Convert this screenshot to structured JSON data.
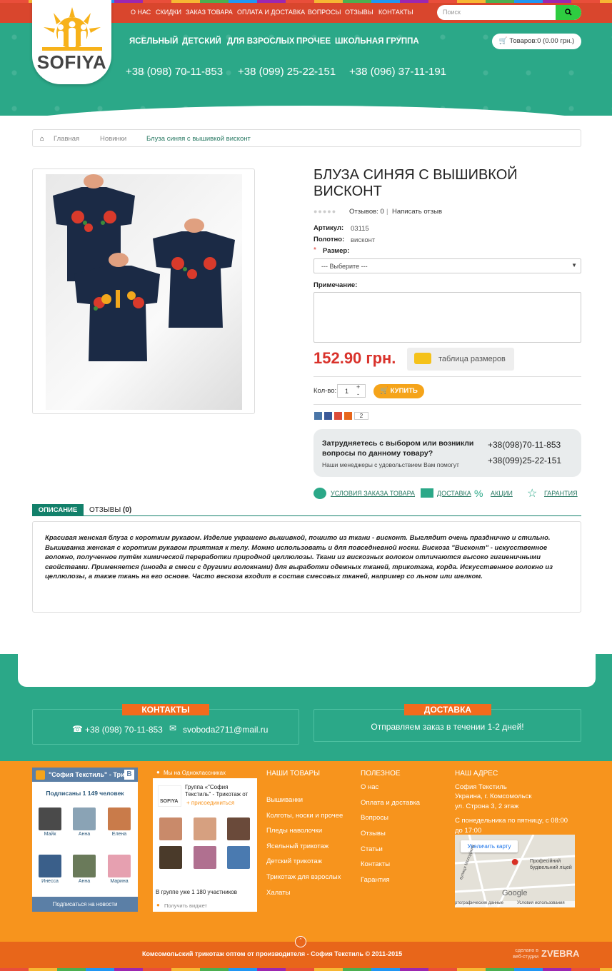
{
  "header": {
    "logo_text": "SOFIYA",
    "top_nav": [
      "О НАС",
      "СКИДКИ",
      "ЗАКАЗ ТОВАРА",
      "ОПЛАТА И ДОСТАВКА",
      "ВОПРОСЫ",
      "ОТЗЫВЫ",
      "КОНТАКТЫ"
    ],
    "search_placeholder": "Поиск",
    "categories": [
      "ЯСЕЛЬНЫЙ",
      "ДЕТСКИЙ",
      "ДЛЯ ВЗРОСЛЫХ",
      "ПРОЧЕЕ",
      "ШКОЛЬНАЯ ГРУППА"
    ],
    "phones": [
      "+38 (098) 70-11-853",
      "+38 (099) 25-22-151",
      "+38 (096) 37-11-191"
    ],
    "cart": "Товаров:0 (0.00 грн.)"
  },
  "breadcrumb": [
    "Главная",
    "Новинки",
    "Блуза синяя с вышивкой висконт"
  ],
  "product": {
    "title": "Блуза синяя с вышивкой висконт",
    "reviews": "Отзывов: 0",
    "write_review": "Написать отзыв",
    "sku_label": "Артикул:",
    "sku": "03115",
    "fabric_label": "Полотно:",
    "fabric": "висконт",
    "size_label": "Размер:",
    "size_select": "--- Выберите ---",
    "note_label": "Примечание:",
    "price": "152.90 грн.",
    "size_table": "таблица размеров",
    "qty_label": "Кол-во:",
    "qty": "1",
    "buy": "КУПИТЬ",
    "share_count": "2"
  },
  "help": {
    "question": "Затрудняетесь с выбором или возникли вопросы по данному товару?",
    "sub": "Наши менеджеры с удовольствием Вам помогут",
    "phone1": "+38(098)70-11-853",
    "phone2": "+38(099)25-22-151"
  },
  "links": [
    "УСЛОВИЯ ЗАКАЗА ТОВАРА",
    "ДОСТАВКА",
    "АКЦИИ",
    "ГАРАНТИЯ"
  ],
  "tabs": {
    "description": "ОПИСАНИЕ",
    "reviews": "ОТЗЫВЫ",
    "reviews_count": "(0)"
  },
  "description": "Красивая женская блуза с коротким рукавом. Изделие украшено вышивкой, пошито  из ткани - висконт. Выглядит очень празднично и стильно. Вышиванка женская с коротким рукавом приятная к телу. Можно использовать и для повседневной носки. Вискоза \"Висконт\" - искусственное волокно, полученное путём химической переработки природной целлюлозы. Ткани из вискозных волокон отличаются высоко гигиеничными свойствами. Применяется (иногда в смеси с другими волокнами) для выработки одежных тканей, трикотажа, корда. Искусственное волокно из целлюлозы, а также ткань на его основе. Часто вескоза входит в состав смесовых тканей, например со льном или шелком.",
  "contacts": {
    "title": "КОНТАКТЫ",
    "phone": "+38 (098) 70-11-853",
    "email": "svoboda2711@mail.ru"
  },
  "delivery": {
    "title": "ДОСТАВКА",
    "text": "Отправляем заказ в течении 1-2 дней!"
  },
  "vk": {
    "title": "\"София Текстиль\" - Три...",
    "subscribed": "Подписаны 1 149 человек",
    "names": [
      "Майк",
      "Анна",
      "Елена",
      "Инесса",
      "Анна",
      "Марина"
    ],
    "button": "Подписаться на новости"
  },
  "ok": {
    "title": "Мы на Одноклассниках",
    "group": "Группа «\"София Текстиль\" - Трикотаж от",
    "join": "присоединиться",
    "members": "В группе уже 1 180 участников",
    "get": "Получить виджет"
  },
  "footer": {
    "goods_title": "НАШИ ТОВАРЫ",
    "goods": [
      "Вышиванки",
      "Колготы, носки и прочее",
      "Пледы наволочки",
      "Ясельный трикотаж",
      "Детский трикотаж",
      "Трикотаж для взрослых",
      "Халаты"
    ],
    "useful_title": "ПОЛЕЗНОЕ",
    "useful": [
      "О нас",
      "Оплата и доставка",
      "Вопросы",
      "Отзывы",
      "Статьи",
      "Контакты",
      "Гарантия"
    ],
    "address_title": "НАШ АДРЕС",
    "address": [
      "София Текстиль",
      "Украина, г. Комсомольск",
      "ул. Строна 3, 2 этаж",
      "С понедельника по пятницу, с 08:00 до 17:00"
    ],
    "map_button": "Увеличить карту",
    "map_label": "Професійний будівельний ліцей",
    "map_street": "вулиця Молодіжна",
    "map_google": "Google",
    "map_data": "ртографические данные",
    "map_terms": "Условия использования",
    "copyright": "Комсомольский трикотаж оптом от производителя - София Текстиль © 2011-2015",
    "made_by": "сделано в веб-студии",
    "studio": "ZVEBRA"
  },
  "colors": {
    "teal": "#2ba888",
    "red": "#d9462d",
    "orange": "#f7941d",
    "price": "#d9322b",
    "buy": "#f5a41a"
  }
}
